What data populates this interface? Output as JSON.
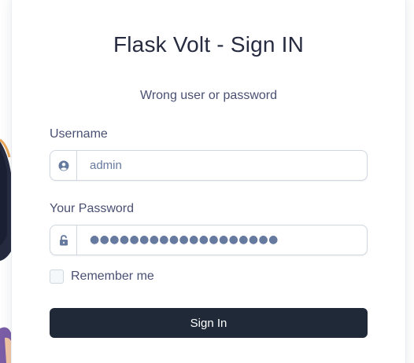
{
  "page": {
    "title": "Flask Volt - Sign IN",
    "message": "Wrong user or password"
  },
  "form": {
    "username_label": "Username",
    "username_value": "admin",
    "username_icon": "user-circle-icon",
    "password_label": "Your Password",
    "password_value_masked": "●●●●●●●●●●●●●●●●●●●",
    "password_icon": "unlock-icon",
    "remember_label": "Remember me",
    "remember_checked": false,
    "submit_label": "Sign In"
  },
  "colors": {
    "button_bg": "#1f2937",
    "text_dark": "#262b40",
    "text_muted": "#4a5073",
    "border": "#d1d7e0"
  }
}
